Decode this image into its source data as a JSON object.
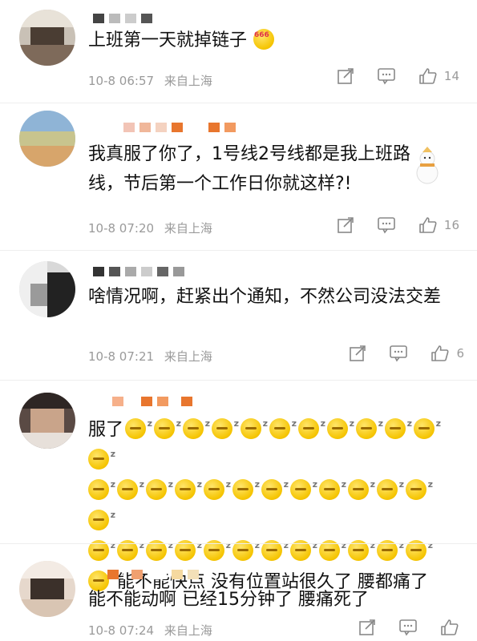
{
  "comments": [
    {
      "text": "上班第一天就掉链子",
      "emoji": "666-emoji",
      "emoji_text": "666",
      "date": "10-8 06:57",
      "location": "来自上海",
      "likes": "14"
    },
    {
      "text": "我真服了你了，1号线2号线都是我上班路线，节后第一个工作日你就这样?!",
      "date": "10-8 07:20",
      "location": "来自上海",
      "likes": "16"
    },
    {
      "text": "啥情况啊，赶紧出个通知，不然公司没法交差",
      "date": "10-8 07:21",
      "location": "来自上海",
      "likes": "6"
    },
    {
      "text_start": "服了",
      "emoji": "sleepy-emoji",
      "emoji_count_row1": 12,
      "emoji_count_row2": 13,
      "emoji_count_row3": 13,
      "text_end": "能不能快点 没有位置站很久了 腰都痛了"
    },
    {
      "text": "能不能动啊 已经15分钟了 腰痛死了",
      "date": "10-8 07:24",
      "location": "来自上海"
    }
  ],
  "icons": {
    "share": "share-icon",
    "reply": "reply-icon",
    "like": "thumbs-up-icon"
  },
  "colors": {
    "meta_text": "#9a9a9a",
    "body_text": "#111111"
  }
}
